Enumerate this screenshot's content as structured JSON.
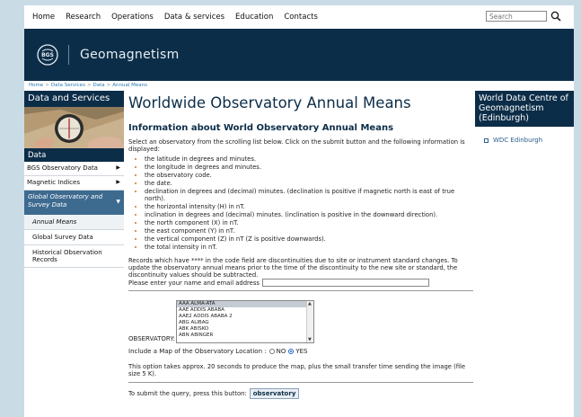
{
  "nav": {
    "items": [
      "Home",
      "Research",
      "Operations",
      "Data & services",
      "Education",
      "Contacts"
    ]
  },
  "search": {
    "placeholder": "Search"
  },
  "banner": {
    "logo_text": "BGS",
    "title": "Geomagnetism"
  },
  "breadcrumb": [
    "Home",
    "Data Services",
    "Data",
    "Annual Means"
  ],
  "sidebar": {
    "header": "Data and Services",
    "section": "Data",
    "items": [
      "BGS Observatory Data",
      "Magnetic Indices"
    ],
    "active": "Global Observatory and Survey Data",
    "subitems": [
      "Annual Means",
      "Global Survey Data",
      "Historical Observation Records"
    ]
  },
  "main": {
    "title": "Worldwide Observatory Annual Means",
    "subtitle": "Information about World Observatory Annual Means",
    "intro": "Select an observatory from the scrolling list below. Click on the submit button and the following information is displayed:",
    "bullets": [
      "the latitude in degrees and minutes.",
      "the longitude in degrees and minutes.",
      "the observatory code.",
      "the date.",
      "declination in degrees and (decimal) minutes. (declination is positive if magnetic north is east of true north).",
      "the horizontal intensity (H) in nT.",
      "inclination in degrees and (decimal) minutes. (inclination is positive in the downward direction).",
      "the north component (X) in nT.",
      "the east component (Y) in nT.",
      "the vertical component (Z) in nT (Z is positive downwards).",
      "the total intensity in nT."
    ],
    "discontinuity": "Records which have **** in the code field are discontinuities due to site or instrument standard changes. To update the observatory annual means prior to the time of the discontinuity to the new site or standard, the discontinuity values should be subtracted.",
    "email_label": "Please enter your name and email address",
    "observatory_label": "OBSERVATORY:",
    "observatories": [
      "AAA ALMA-ATA",
      "AAE ADDIS ABABA",
      "AAE2 ADDIS ABABA 2",
      "ABG ALIBAG",
      "ABK ABISKO",
      "ABN ABINGER"
    ],
    "map_label": "Include a Map of the Observatory Location :",
    "map_no": "NO",
    "map_yes": "YES",
    "note": "This option takes approx. 20 seconds to produce the map, plus the small transfer time sending the image (file size 5 K).",
    "submit_label": "To submit the query, press this button:",
    "submit_button": "observatory"
  },
  "rightbar": {
    "header": "World Data Centre of Geomagnetism (Edinburgh)",
    "link": "WDC Edinburgh"
  }
}
